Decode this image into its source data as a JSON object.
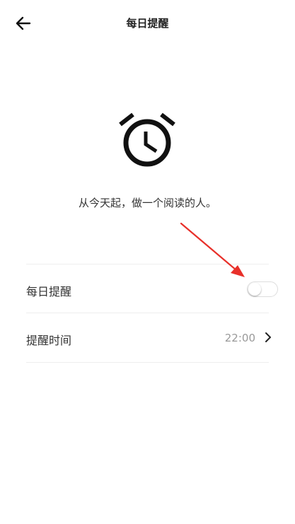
{
  "header": {
    "title": "每日提醒",
    "back_icon": "arrow-left-icon"
  },
  "hero": {
    "icon": "alarm-clock-icon",
    "slogan": "从今天起，做一个阅读的人。"
  },
  "settings": {
    "daily_reminder": {
      "label": "每日提醒",
      "enabled": false
    },
    "reminder_time": {
      "label": "提醒时间",
      "value": "22:00",
      "icon": "chevron-right-icon"
    }
  },
  "annotation": {
    "icon": "red-pointer-arrow-icon",
    "color": "#e8302a"
  }
}
